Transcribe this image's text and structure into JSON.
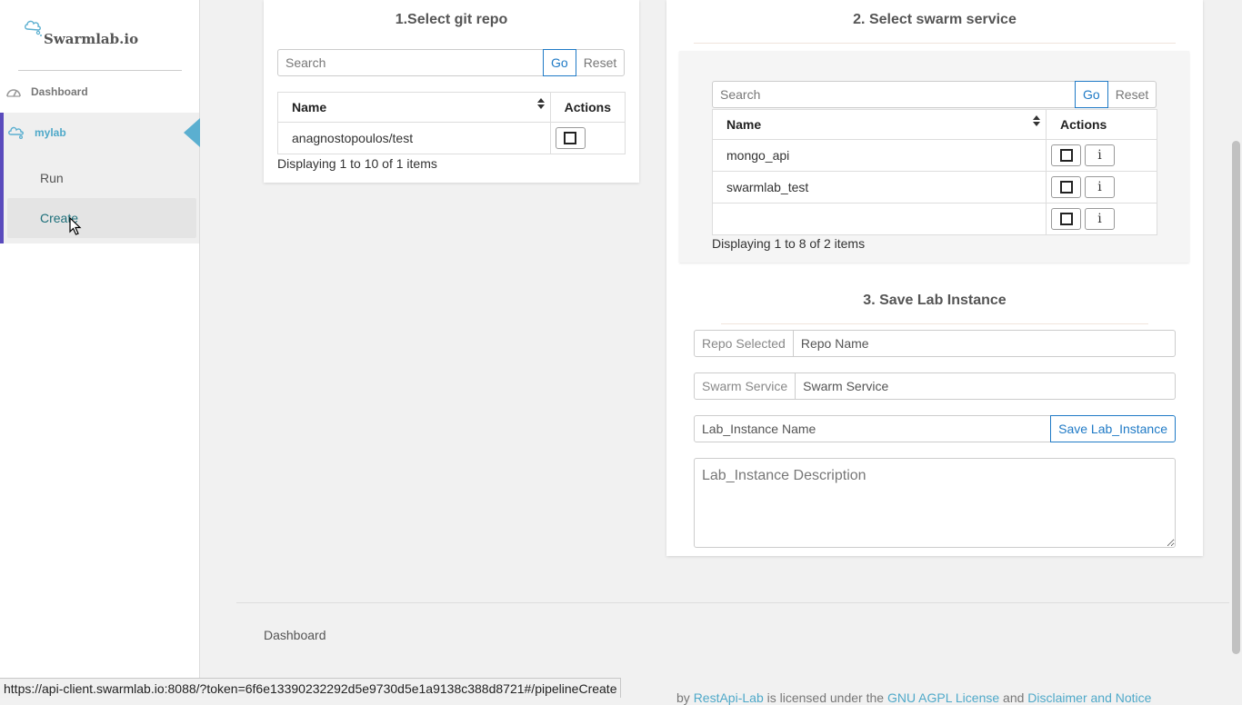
{
  "app": {
    "brand": "Swarmlab.io"
  },
  "sidebar": {
    "dashboard_label": "Dashboard",
    "group_label": "mylab",
    "items": [
      {
        "label": "Run"
      },
      {
        "label": "Create"
      }
    ]
  },
  "git_repo": {
    "title": "1.Select git repo",
    "search_placeholder": "Search",
    "go_label": "Go",
    "reset_label": "Reset",
    "columns": [
      "Name",
      "Actions"
    ],
    "rows": [
      {
        "name": "anagnostopoulos/test"
      }
    ],
    "display_info": "Displaying 1 to 10 of 1 items"
  },
  "swarm_service": {
    "title": "2. Select swarm service",
    "search_placeholder": "Search",
    "go_label": "Go",
    "reset_label": "Reset",
    "columns": [
      "Name",
      "Actions"
    ],
    "rows": [
      {
        "name": "mongo_api"
      },
      {
        "name": "swarmlab_test"
      },
      {
        "name": ""
      }
    ],
    "info_glyph": "i",
    "display_info": "Displaying 1 to 8 of 2 items"
  },
  "save_lab": {
    "title": "3. Save Lab Instance",
    "repo_addon": "Repo Selected",
    "repo_placeholder": "Repo Name",
    "service_addon": "Swarm Service",
    "service_placeholder": "Swarm Service",
    "name_placeholder": "Lab_Instance Name",
    "save_label": "Save Lab_Instance",
    "description_placeholder": "Lab_Instance Description"
  },
  "footer": {
    "dashboard_link": "Dashboard",
    "partial_prefix": "by",
    "partial_link1": "RestApi-Lab",
    "partial_mid": "is licensed under the",
    "partial_link2": "GNU AGPL License",
    "partial_link3": "Disclaimer and Notice"
  },
  "status_bar": {
    "url": "https://api-client.swarmlab.io:8088/?token=6f6e13390232292d5e9730d5e1a9138c388d8721#/pipelineCreate"
  },
  "icons": {
    "brand": "cloud-icon",
    "dashboard": "dashboard-gauge-icon",
    "mylab": "cloud-icon",
    "sort": "sort-icon",
    "select": "checkbox-icon",
    "info": "info-icon"
  },
  "colors": {
    "accent": "#1f7ac6",
    "sidebar_active_bar": "#5a4bbd",
    "sidebar_highlight": "#4fa9c9"
  }
}
